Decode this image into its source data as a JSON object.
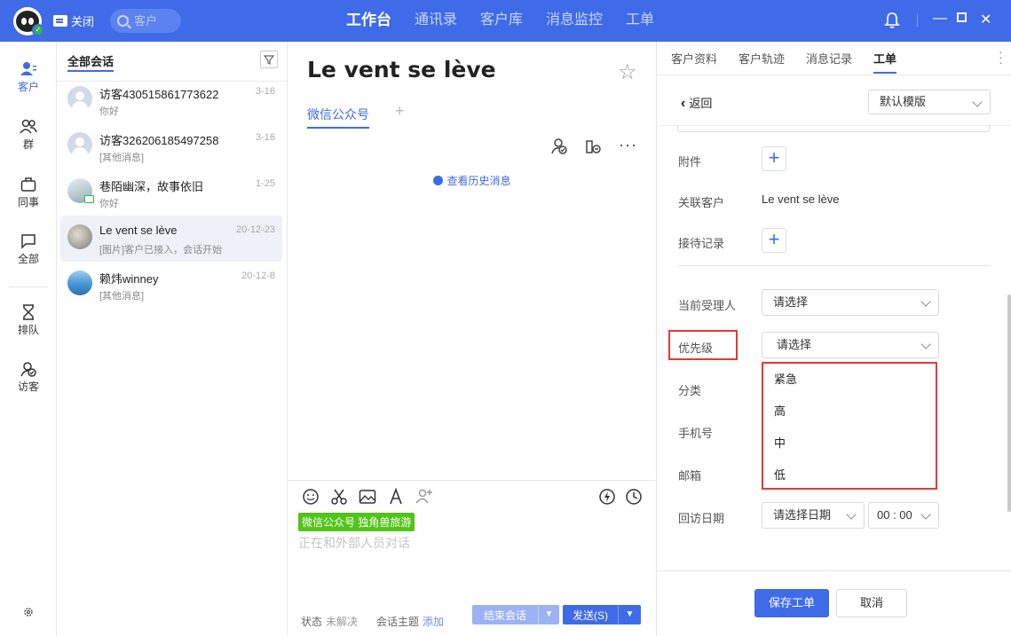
{
  "topbar": {
    "close_label": "关闭",
    "search_placeholder": "客户",
    "nav": [
      "工作台",
      "通讯录",
      "客户库",
      "消息监控",
      "工单"
    ],
    "active_nav": "工作台",
    "brand_color": "#3f6be8"
  },
  "rail": {
    "items": [
      {
        "label": "客户",
        "icon": "customer-icon"
      },
      {
        "label": "群",
        "icon": "group-icon"
      },
      {
        "label": "同事",
        "icon": "briefcase-icon"
      },
      {
        "label": "全部",
        "icon": "chat-bubble-icon"
      },
      {
        "label": "排队",
        "icon": "hourglass-icon"
      },
      {
        "label": "访客",
        "icon": "visitor-icon"
      }
    ],
    "settings_icon": "settings-icon"
  },
  "conversations": {
    "header": "全部会话",
    "items": [
      {
        "name": "访客430515861773622",
        "time": "3-16",
        "snippet": "你好"
      },
      {
        "name": "访客326206185497258",
        "time": "3-16",
        "snippet": "[其他消息]"
      },
      {
        "name": "巷陌幽深，故事依旧",
        "time": "1-25",
        "snippet": "你好"
      },
      {
        "name": "Le vent se lève",
        "time": "20-12-23",
        "snippet": "[图片]客户已接入，会话开始"
      },
      {
        "name": "赖炜winney",
        "time": "20-12-8",
        "snippet": "[其他消息]"
      }
    ],
    "selected_index": 3
  },
  "chat": {
    "title": "Le vent se lève",
    "channel_tab": "微信公众号",
    "add_tab": "+",
    "history_link": "查看历史消息",
    "more_glyph": "···",
    "channel_tag": "微信公众号 独角兽旅游",
    "input_placeholder": "正在和外部人员对话",
    "status_label": "状态",
    "status_value": "未解决",
    "topic_label": "会话主题",
    "topic_add": "添加",
    "end_button": "结束会话",
    "send_button": "发送(S)"
  },
  "right": {
    "tabs": [
      "客户资料",
      "客户轨迹",
      "消息记录",
      "工单"
    ],
    "active_tab": "工单",
    "back": "返回",
    "template": "默认模版",
    "fields": {
      "attachment": "附件",
      "linked_customer": "关联客户",
      "linked_customer_value": "Le vent se lève",
      "reception_record": "接待记录",
      "assignee": "当前受理人",
      "assignee_value": "请选择",
      "priority": "优先级",
      "priority_value": "请选择",
      "category": "分类",
      "phone": "手机号",
      "email": "邮箱",
      "revisit_date": "回访日期",
      "revisit_date_value": "请选择日期",
      "revisit_time_value": "00 : 00"
    },
    "priority_options": [
      "紧急",
      "高",
      "中",
      "低"
    ],
    "save_button": "保存工单",
    "cancel_button": "取消",
    "highlight_color": "#e53935"
  }
}
